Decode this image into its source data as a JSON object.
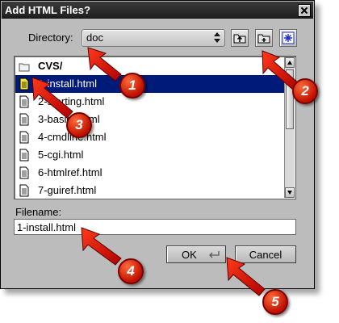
{
  "dialog": {
    "title": "Add HTML Files?"
  },
  "directory": {
    "label": "Directory:",
    "value": "doc"
  },
  "toolbar": {
    "up_icon": "parent-folder-icon",
    "new_folder_icon": "new-folder-icon",
    "refresh_icon": "asterisk-icon"
  },
  "files": {
    "items": [
      {
        "label": "CVS/",
        "type": "folder"
      },
      {
        "label": "1-install.html",
        "type": "file",
        "selected": true
      },
      {
        "label": "2-starting.html",
        "type": "file"
      },
      {
        "label": "3-basics.html",
        "type": "file"
      },
      {
        "label": "4-cmdline.html",
        "type": "file"
      },
      {
        "label": "5-cgi.html",
        "type": "file"
      },
      {
        "label": "6-htmlref.html",
        "type": "file"
      },
      {
        "label": "7-guiref.html",
        "type": "file"
      }
    ]
  },
  "filename": {
    "label": "Filename:",
    "value": "1-install.html"
  },
  "buttons": {
    "ok": "OK",
    "cancel": "Cancel"
  },
  "annotations": [
    "1",
    "2",
    "3",
    "4",
    "5"
  ],
  "colors": {
    "selection": "#001a7a",
    "arrow": "#e81800",
    "dialog_bg": "#bcbcbc"
  }
}
